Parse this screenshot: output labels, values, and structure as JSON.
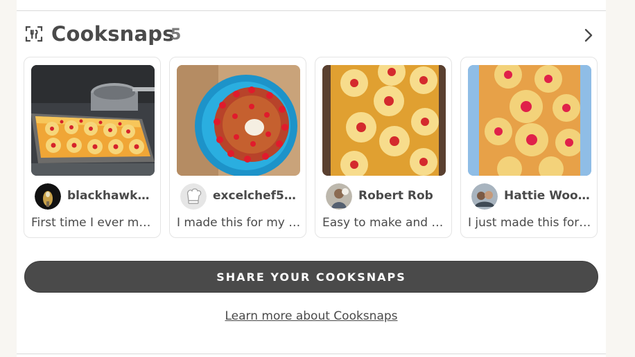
{
  "section": {
    "title": "Cooksnaps",
    "count": "5",
    "icon": "cooksnap-camera-utensils-icon",
    "next_icon": "chevron-right-icon"
  },
  "cards": [
    {
      "user": "blackhawk2...",
      "caption": "First time I ever ma...",
      "photo": "pineapple upside-down cake in baking pan"
    },
    {
      "user": "excelchef55...",
      "caption": "I made this for my f...",
      "photo": "round pineapple cake on blue plate"
    },
    {
      "user": "Robert Rob",
      "caption": "Easy to make and d...",
      "photo": "pineapple rings with cherries in pan"
    },
    {
      "user": "Hattie Wool...",
      "caption": "I just made this for ...",
      "photo": "pineapple cake slab on blue towel"
    }
  ],
  "share_button": {
    "label": "SHARE YOUR COOKSNAPS"
  },
  "learn_more": {
    "label": "Learn more about Cooksnaps"
  },
  "colors": {
    "text": "#4a4a4a",
    "button": "#4a4a4a",
    "background": "#f8f6f2"
  }
}
